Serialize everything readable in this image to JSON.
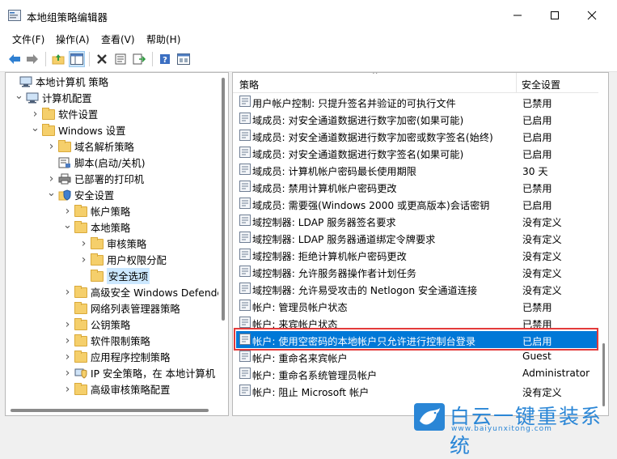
{
  "window": {
    "title": "本地组策略编辑器"
  },
  "menu": [
    "文件(F)",
    "操作(A)",
    "查看(V)",
    "帮助(H)"
  ],
  "tree": [
    {
      "label": "本地计算机 策略",
      "icon": "computer-policy-icon",
      "twisty": ""
    },
    {
      "label": "计算机配置",
      "icon": "computer-icon",
      "twisty": "open"
    },
    {
      "label": "软件设置",
      "icon": "folder-icon",
      "twisty": "closed"
    },
    {
      "label": "Windows 设置",
      "icon": "folder-icon",
      "twisty": "open"
    },
    {
      "label": "域名解析策略",
      "icon": "folder-icon",
      "twisty": "closed"
    },
    {
      "label": "脚本(启动/关机)",
      "icon": "script-icon",
      "twisty": ""
    },
    {
      "label": "已部署的打印机",
      "icon": "printer-icon",
      "twisty": "closed"
    },
    {
      "label": "安全设置",
      "icon": "security-icon",
      "twisty": "open"
    },
    {
      "label": "帐户策略",
      "icon": "folder-icon",
      "twisty": "closed"
    },
    {
      "label": "本地策略",
      "icon": "folder-icon",
      "twisty": "open"
    },
    {
      "label": "审核策略",
      "icon": "folder-icon",
      "twisty": "closed"
    },
    {
      "label": "用户权限分配",
      "icon": "folder-icon",
      "twisty": "closed"
    },
    {
      "label": "安全选项",
      "icon": "folder-icon",
      "twisty": "",
      "selected": true
    },
    {
      "label": "高级安全 Windows Defende",
      "icon": "folder-icon",
      "twisty": "closed"
    },
    {
      "label": "网络列表管理器策略",
      "icon": "folder-icon",
      "twisty": ""
    },
    {
      "label": "公钥策略",
      "icon": "folder-icon",
      "twisty": "closed"
    },
    {
      "label": "软件限制策略",
      "icon": "folder-icon",
      "twisty": "closed"
    },
    {
      "label": "应用程序控制策略",
      "icon": "folder-icon",
      "twisty": "closed"
    },
    {
      "label": "IP 安全策略，在 本地计算机",
      "icon": "ip-security-icon",
      "twisty": "closed"
    },
    {
      "label": "高级审核策略配置",
      "icon": "folder-icon",
      "twisty": "closed"
    }
  ],
  "list": {
    "col_policy": "策略",
    "col_setting": "安全设置",
    "rows": [
      {
        "name": "用户帐户控制: 只提升签名并验证的可执行文件",
        "value": "已禁用"
      },
      {
        "name": "域成员: 对安全通道数据进行数字加密(如果可能)",
        "value": "已启用"
      },
      {
        "name": "域成员: 对安全通道数据进行数字加密或数字签名(始终)",
        "value": "已启用"
      },
      {
        "name": "域成员: 对安全通道数据进行数字签名(如果可能)",
        "value": "已启用"
      },
      {
        "name": "域成员: 计算机帐户密码最长使用期限",
        "value": "30 天"
      },
      {
        "name": "域成员: 禁用计算机帐户密码更改",
        "value": "已禁用"
      },
      {
        "name": "域成员: 需要强(Windows 2000 或更高版本)会话密钥",
        "value": "已启用"
      },
      {
        "name": "域控制器: LDAP 服务器签名要求",
        "value": "没有定义"
      },
      {
        "name": "域控制器: LDAP 服务器通道绑定令牌要求",
        "value": "没有定义"
      },
      {
        "name": "域控制器: 拒绝计算机帐户密码更改",
        "value": "没有定义"
      },
      {
        "name": "域控制器: 允许服务器操作者计划任务",
        "value": "没有定义"
      },
      {
        "name": "域控制器: 允许易受攻击的 Netlogon 安全通道连接",
        "value": "没有定义"
      },
      {
        "name": "帐户: 管理员帐户状态",
        "value": "已禁用"
      },
      {
        "name": "帐户: 来宾帐户状态",
        "value": "已禁用"
      },
      {
        "name": "帐户: 使用空密码的本地帐户只允许进行控制台登录",
        "value": "已启用",
        "highlighted": true
      },
      {
        "name": "帐户: 重命名来宾帐户",
        "value": "Guest"
      },
      {
        "name": "帐户: 重命名系统管理员帐户",
        "value": "Administrator"
      },
      {
        "name": "帐户: 阻止 Microsoft 帐户",
        "value": "没有定义"
      }
    ]
  },
  "watermark": {
    "brand": "白云一键重装系统",
    "url": "www.baiyunxitong.com"
  },
  "colors": {
    "selection": "#0078d7",
    "callout": "#e33a3a",
    "brand": "#2a86d6"
  }
}
